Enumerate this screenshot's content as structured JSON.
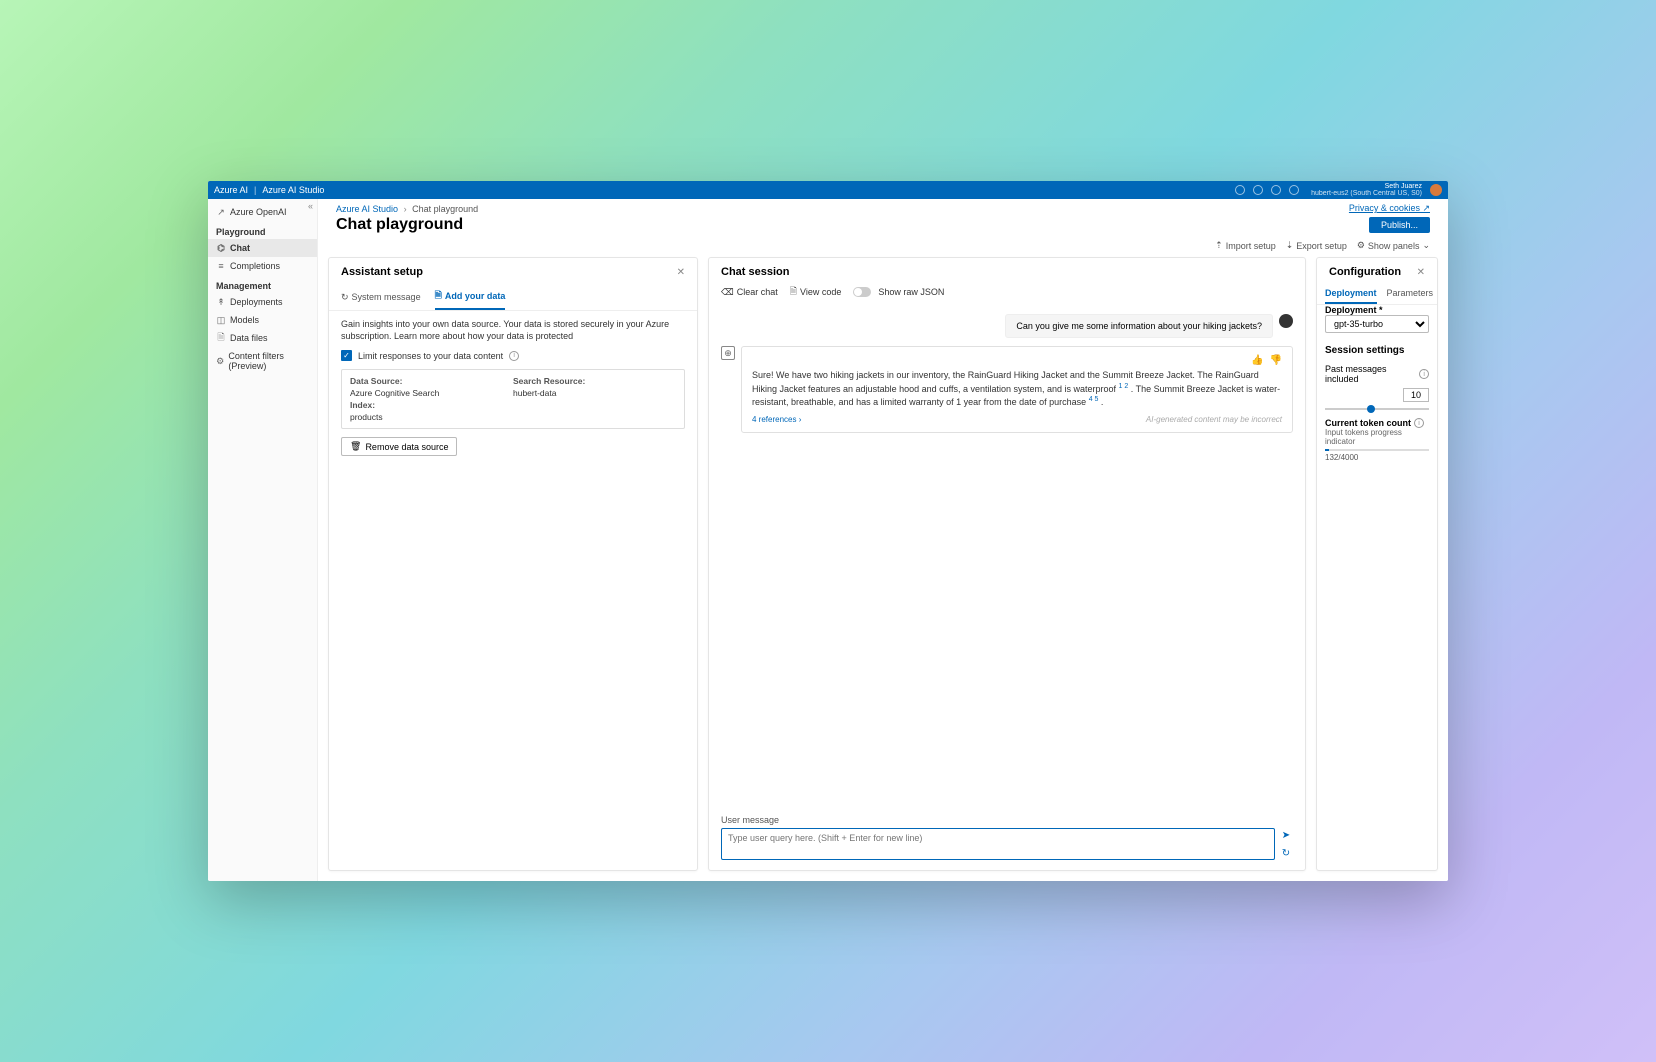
{
  "topbar": {
    "brand_a": "Azure AI",
    "brand_b": "Azure AI Studio",
    "user_name": "Seth Juarez",
    "user_sub": "hubert-eus2 (South Central US, S0)"
  },
  "sidebar": {
    "items": [
      {
        "icon": "↗",
        "label": "Azure OpenAI"
      }
    ],
    "section_playground": "Playground",
    "playground_items": [
      {
        "icon": "⌬",
        "label": "Chat",
        "active": true
      },
      {
        "icon": "≡",
        "label": "Completions"
      }
    ],
    "section_mgmt": "Management",
    "mgmt_items": [
      {
        "icon": "↟",
        "label": "Deployments"
      },
      {
        "icon": "◫",
        "label": "Models"
      },
      {
        "icon": "🗎",
        "label": "Data files"
      },
      {
        "icon": "⚙",
        "label": "Content filters (Preview)"
      }
    ]
  },
  "crumbs": {
    "a": "Azure AI Studio",
    "b": "Chat playground",
    "privacy": "Privacy & cookies ↗"
  },
  "page_title": "Chat playground",
  "title_actions": {
    "publish": "Publish...",
    "import": "Import setup",
    "export": "Export setup",
    "show_panels": "Show panels"
  },
  "setup": {
    "title": "Assistant setup",
    "tabs": {
      "sys": "System message",
      "data": "Add your data"
    },
    "insight": "Gain insights into your own data source. Your data is stored securely in your Azure subscription. Learn more about how your data is protected",
    "limit_label": "Limit responses to your data content",
    "data": {
      "src_lab": "Data Source:",
      "src_val": "Azure Cognitive Search",
      "res_lab": "Search Resource:",
      "res_val": "hubert-data",
      "idx_lab": "Index:",
      "idx_val": "products"
    },
    "remove": "Remove data source"
  },
  "chat": {
    "title": "Chat session",
    "clear": "Clear chat",
    "view_code": "View code",
    "show_json": "Show raw JSON",
    "user_msg": "Can you give me some information about your hiking jackets?",
    "bot_msg_a": "Sure! We have two hiking jackets in our inventory, the RainGuard Hiking Jacket and the Summit Breeze Jacket. The RainGuard Hiking Jacket features an adjustable hood and cuffs, a ventilation system, and is waterproof ",
    "bot_sup1": "1 2",
    "bot_msg_b": " . The Summit Breeze Jacket is water-resistant, breathable, and has a limited warranty of 1 year from the date of purchase ",
    "bot_sup2": "4 5",
    "bot_msg_c": " .",
    "refs": "4 references  ›",
    "disclaimer": "AI-generated content may be incorrect",
    "input_label": "User message",
    "placeholder": "Type user query here. (Shift + Enter for new line)"
  },
  "config": {
    "title": "Configuration",
    "tabs": {
      "dep": "Deployment",
      "par": "Parameters"
    },
    "dep_label": "Deployment *",
    "dep_val": "gpt-35-turbo",
    "session_title": "Session settings",
    "past_label": "Past messages included",
    "past_val": "10",
    "token_title": "Current token count",
    "prog_label": "Input tokens progress indicator",
    "tokens": "132/4000"
  }
}
